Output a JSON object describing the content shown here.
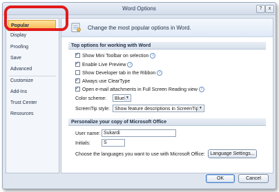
{
  "window": {
    "title": "Word Options",
    "help_glyph": "?",
    "close_glyph": "x"
  },
  "sidebar": {
    "items": [
      {
        "label": "Popular",
        "active": true
      },
      {
        "label": "Display"
      },
      {
        "label": "Proofing"
      },
      {
        "label": "Save"
      },
      {
        "label": "Advanced"
      },
      {
        "label": "Customize"
      },
      {
        "label": "Add-Ins"
      },
      {
        "label": "Trust Center"
      },
      {
        "label": "Resources"
      }
    ]
  },
  "header": {
    "text": "Change the most popular options in Word.",
    "icon": "options-icon"
  },
  "top_options": {
    "title": "Top options for working with Word",
    "checkboxes": [
      {
        "label": "Show Mini Toolbar on selection",
        "checked": true,
        "info": true
      },
      {
        "label": "Enable Live Preview",
        "checked": true,
        "info": true
      },
      {
        "label": "Show Developer tab in the Ribbon",
        "checked": false,
        "info": true
      },
      {
        "label": "Always use ClearType",
        "checked": true,
        "info": false
      },
      {
        "label": "Open e-mail attachments in Full Screen Reading view",
        "checked": true,
        "info": true
      }
    ],
    "color_scheme_label": "Color scheme:",
    "color_scheme_value": "Blue",
    "screentip_label": "ScreenTip style:",
    "screentip_value": "Show feature descriptions in ScreenTips"
  },
  "personalize": {
    "title": "Personalize your copy of Microsoft Office",
    "username_label": "User name:",
    "username_value": "Sukardi",
    "initials_label": "Initials:",
    "initials_value": "S",
    "languages_text": "Choose the languages you want to use with Microsoft Office:",
    "language_settings_button": "Language Settings..."
  },
  "footer": {
    "ok": "OK",
    "cancel": "Cancel"
  },
  "colors": {
    "highlight_marker": "#e11a1a",
    "active_nav": "#f7b14b"
  }
}
